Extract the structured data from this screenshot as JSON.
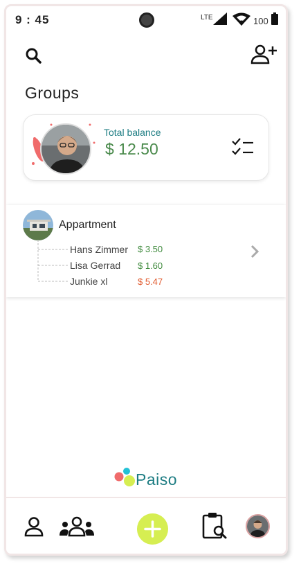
{
  "status_bar": {
    "time": "9 : 45",
    "network": "LTE",
    "battery": "100"
  },
  "header": {
    "title": "Groups",
    "search_icon": "search-icon",
    "add_user_icon": "add-user-icon"
  },
  "balance": {
    "label": "Total balance",
    "value": "$ 12.50",
    "checklist_icon": "checklist-icon"
  },
  "groups": [
    {
      "name": "Appartment",
      "members": [
        {
          "name": "Hans Zimmer",
          "amount": "$ 3.50",
          "status": "positive"
        },
        {
          "name": "Lisa Gerrad",
          "amount": "$ 1.60",
          "status": "positive"
        },
        {
          "name": "Junkie xl",
          "amount": "$ 5.47",
          "status": "negative"
        }
      ]
    }
  ],
  "brand": {
    "name": "Paiso"
  },
  "bottom_nav": {
    "items": [
      "person-icon",
      "groups-icon",
      "add-icon",
      "clipboard-search-icon",
      "profile-avatar"
    ]
  },
  "colors": {
    "accent_teal": "#1c7c82",
    "positive_green": "#3f8a3d",
    "negative_orange": "#e0572a",
    "fab_lime": "#d6ee52"
  }
}
